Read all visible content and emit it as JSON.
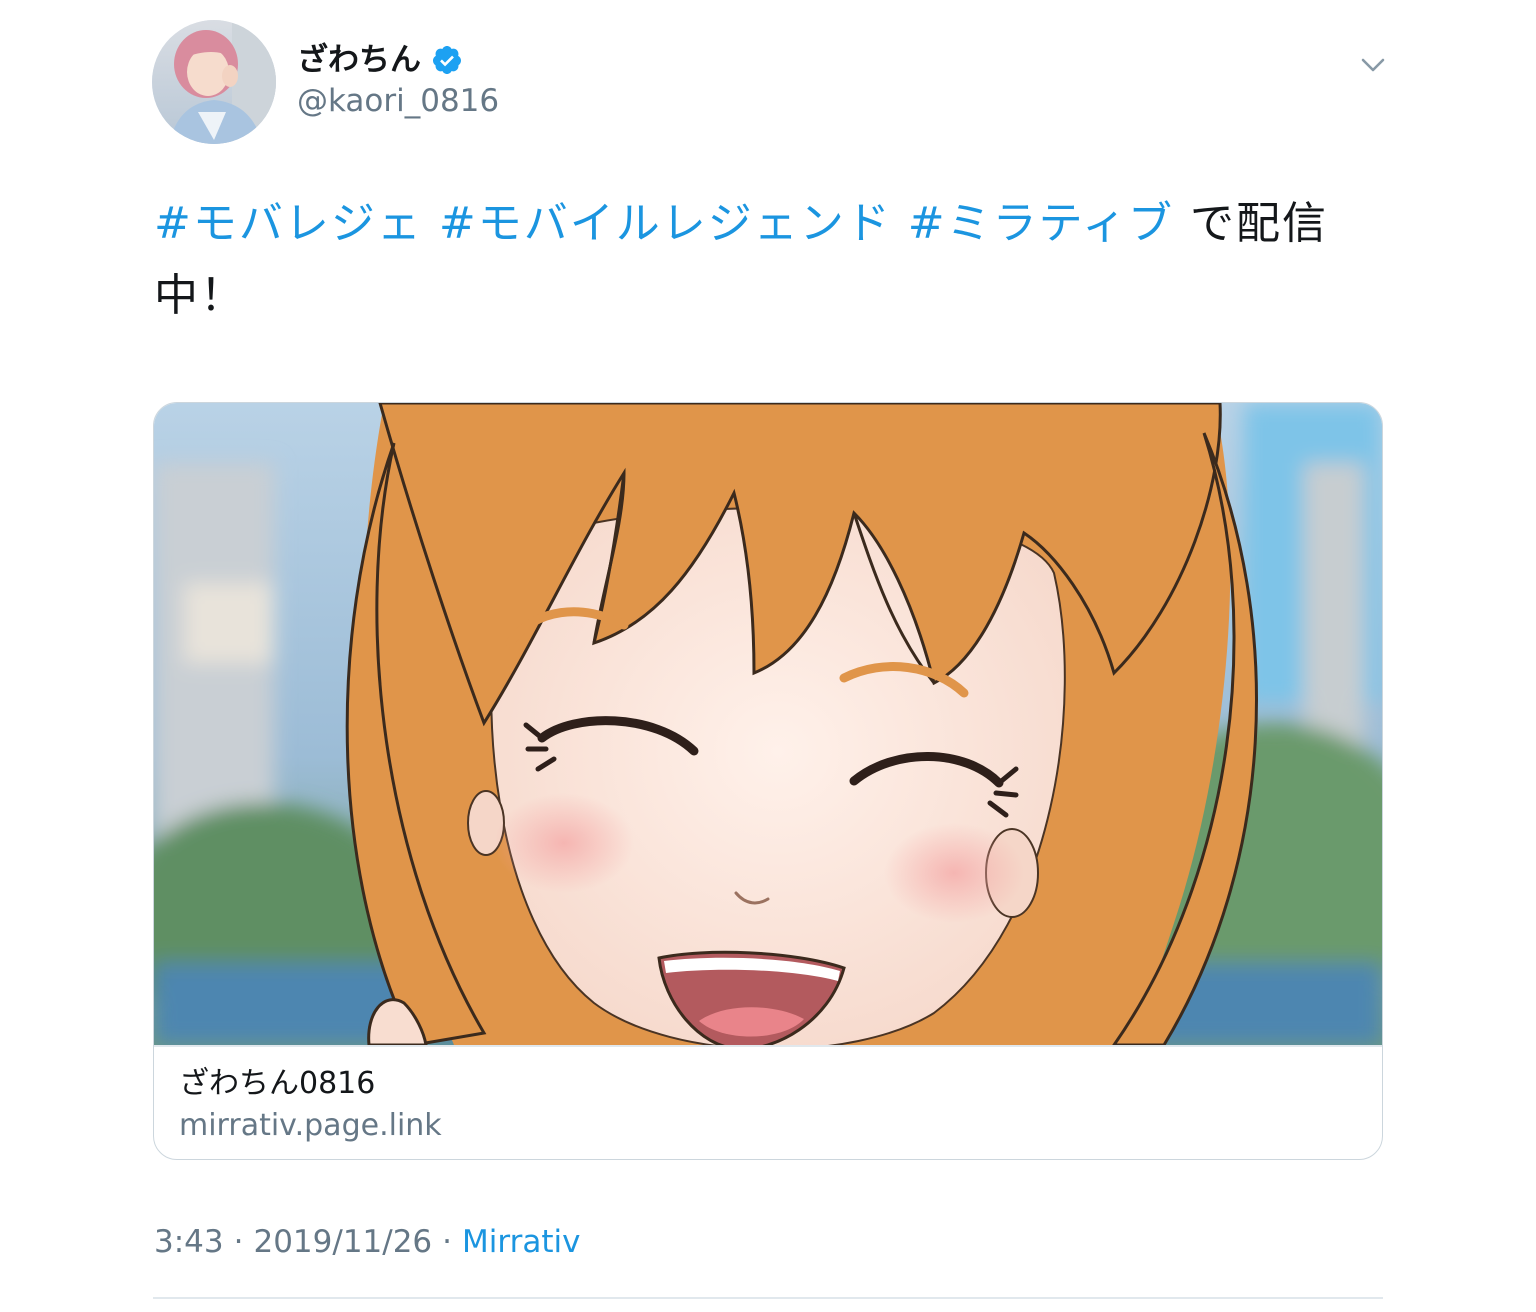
{
  "author": {
    "name": "ざわちん",
    "handle": "@kaori_0816",
    "verified": true
  },
  "tweet": {
    "hashtags": [
      "#モバレジェ",
      "#モバイルレジェンド",
      "#ミラティブ"
    ],
    "text_suffix": "で配信中！"
  },
  "card": {
    "title": "ざわちん0816",
    "domain": "mirrativ.page.link"
  },
  "footer": {
    "time": "3:43",
    "separator": "·",
    "date": "2019/11/26",
    "source": "Mirrativ"
  },
  "colors": {
    "link": "#1b95e0",
    "secondary_text": "#657786",
    "primary_text": "#14171a",
    "border": "#ccd6dd"
  },
  "icons": {
    "verified": "verified-badge-icon",
    "menu": "chevron-down-icon"
  }
}
